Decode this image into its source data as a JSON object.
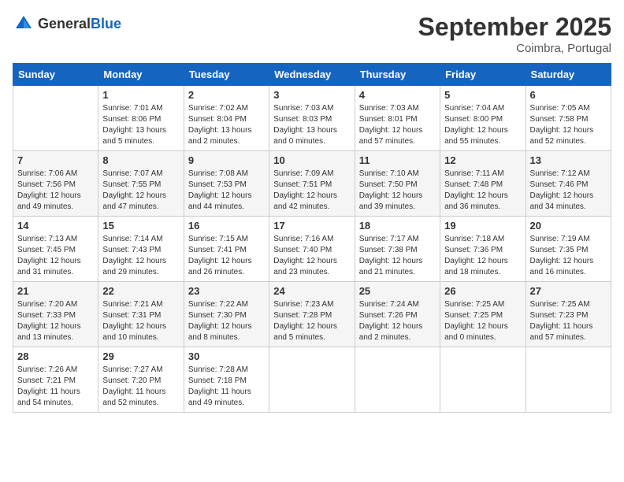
{
  "header": {
    "logo_general": "General",
    "logo_blue": "Blue",
    "month_title": "September 2025",
    "location": "Coimbra, Portugal"
  },
  "days_of_week": [
    "Sunday",
    "Monday",
    "Tuesday",
    "Wednesday",
    "Thursday",
    "Friday",
    "Saturday"
  ],
  "weeks": [
    {
      "shaded": false,
      "days": [
        {
          "num": "",
          "info": ""
        },
        {
          "num": "1",
          "info": "Sunrise: 7:01 AM\nSunset: 8:06 PM\nDaylight: 13 hours\nand 5 minutes."
        },
        {
          "num": "2",
          "info": "Sunrise: 7:02 AM\nSunset: 8:04 PM\nDaylight: 13 hours\nand 2 minutes."
        },
        {
          "num": "3",
          "info": "Sunrise: 7:03 AM\nSunset: 8:03 PM\nDaylight: 13 hours\nand 0 minutes."
        },
        {
          "num": "4",
          "info": "Sunrise: 7:03 AM\nSunset: 8:01 PM\nDaylight: 12 hours\nand 57 minutes."
        },
        {
          "num": "5",
          "info": "Sunrise: 7:04 AM\nSunset: 8:00 PM\nDaylight: 12 hours\nand 55 minutes."
        },
        {
          "num": "6",
          "info": "Sunrise: 7:05 AM\nSunset: 7:58 PM\nDaylight: 12 hours\nand 52 minutes."
        }
      ]
    },
    {
      "shaded": true,
      "days": [
        {
          "num": "7",
          "info": "Sunrise: 7:06 AM\nSunset: 7:56 PM\nDaylight: 12 hours\nand 49 minutes."
        },
        {
          "num": "8",
          "info": "Sunrise: 7:07 AM\nSunset: 7:55 PM\nDaylight: 12 hours\nand 47 minutes."
        },
        {
          "num": "9",
          "info": "Sunrise: 7:08 AM\nSunset: 7:53 PM\nDaylight: 12 hours\nand 44 minutes."
        },
        {
          "num": "10",
          "info": "Sunrise: 7:09 AM\nSunset: 7:51 PM\nDaylight: 12 hours\nand 42 minutes."
        },
        {
          "num": "11",
          "info": "Sunrise: 7:10 AM\nSunset: 7:50 PM\nDaylight: 12 hours\nand 39 minutes."
        },
        {
          "num": "12",
          "info": "Sunrise: 7:11 AM\nSunset: 7:48 PM\nDaylight: 12 hours\nand 36 minutes."
        },
        {
          "num": "13",
          "info": "Sunrise: 7:12 AM\nSunset: 7:46 PM\nDaylight: 12 hours\nand 34 minutes."
        }
      ]
    },
    {
      "shaded": false,
      "days": [
        {
          "num": "14",
          "info": "Sunrise: 7:13 AM\nSunset: 7:45 PM\nDaylight: 12 hours\nand 31 minutes."
        },
        {
          "num": "15",
          "info": "Sunrise: 7:14 AM\nSunset: 7:43 PM\nDaylight: 12 hours\nand 29 minutes."
        },
        {
          "num": "16",
          "info": "Sunrise: 7:15 AM\nSunset: 7:41 PM\nDaylight: 12 hours\nand 26 minutes."
        },
        {
          "num": "17",
          "info": "Sunrise: 7:16 AM\nSunset: 7:40 PM\nDaylight: 12 hours\nand 23 minutes."
        },
        {
          "num": "18",
          "info": "Sunrise: 7:17 AM\nSunset: 7:38 PM\nDaylight: 12 hours\nand 21 minutes."
        },
        {
          "num": "19",
          "info": "Sunrise: 7:18 AM\nSunset: 7:36 PM\nDaylight: 12 hours\nand 18 minutes."
        },
        {
          "num": "20",
          "info": "Sunrise: 7:19 AM\nSunset: 7:35 PM\nDaylight: 12 hours\nand 16 minutes."
        }
      ]
    },
    {
      "shaded": true,
      "days": [
        {
          "num": "21",
          "info": "Sunrise: 7:20 AM\nSunset: 7:33 PM\nDaylight: 12 hours\nand 13 minutes."
        },
        {
          "num": "22",
          "info": "Sunrise: 7:21 AM\nSunset: 7:31 PM\nDaylight: 12 hours\nand 10 minutes."
        },
        {
          "num": "23",
          "info": "Sunrise: 7:22 AM\nSunset: 7:30 PM\nDaylight: 12 hours\nand 8 minutes."
        },
        {
          "num": "24",
          "info": "Sunrise: 7:23 AM\nSunset: 7:28 PM\nDaylight: 12 hours\nand 5 minutes."
        },
        {
          "num": "25",
          "info": "Sunrise: 7:24 AM\nSunset: 7:26 PM\nDaylight: 12 hours\nand 2 minutes."
        },
        {
          "num": "26",
          "info": "Sunrise: 7:25 AM\nSunset: 7:25 PM\nDaylight: 12 hours\nand 0 minutes."
        },
        {
          "num": "27",
          "info": "Sunrise: 7:25 AM\nSunset: 7:23 PM\nDaylight: 11 hours\nand 57 minutes."
        }
      ]
    },
    {
      "shaded": false,
      "days": [
        {
          "num": "28",
          "info": "Sunrise: 7:26 AM\nSunset: 7:21 PM\nDaylight: 11 hours\nand 54 minutes."
        },
        {
          "num": "29",
          "info": "Sunrise: 7:27 AM\nSunset: 7:20 PM\nDaylight: 11 hours\nand 52 minutes."
        },
        {
          "num": "30",
          "info": "Sunrise: 7:28 AM\nSunset: 7:18 PM\nDaylight: 11 hours\nand 49 minutes."
        },
        {
          "num": "",
          "info": ""
        },
        {
          "num": "",
          "info": ""
        },
        {
          "num": "",
          "info": ""
        },
        {
          "num": "",
          "info": ""
        }
      ]
    }
  ]
}
